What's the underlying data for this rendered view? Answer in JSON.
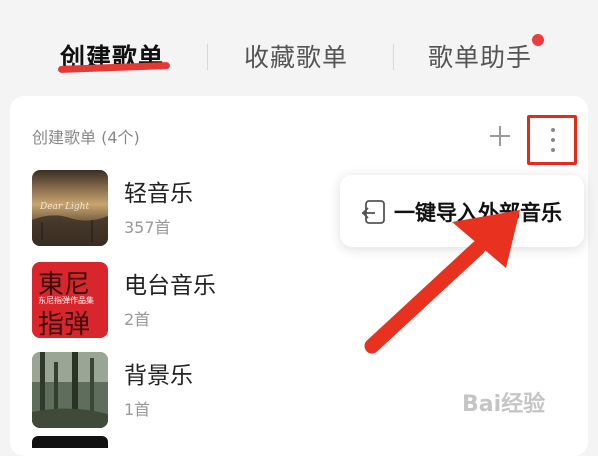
{
  "tabs": {
    "items": [
      {
        "label": "创建歌单",
        "active": true
      },
      {
        "label": "收藏歌单",
        "active": false
      },
      {
        "label": "歌单助手",
        "active": false,
        "has_dot": true
      }
    ]
  },
  "section": {
    "title": "创建歌单 (4个)",
    "actions": {
      "add_icon": "plus-icon",
      "more_icon": "more-vertical-icon"
    }
  },
  "playlists": [
    {
      "name": "轻音乐",
      "count": "357首",
      "cover_text": "Dear Light"
    },
    {
      "name": "电台音乐",
      "count": "2首",
      "cover_text_top": "東尼",
      "cover_text_mid": "东尼指弹作品集",
      "cover_text_bottom": "指弹"
    },
    {
      "name": "背景乐",
      "count": "1首"
    }
  ],
  "popup_menu": {
    "item_label": "一键导入外部音乐",
    "item_icon": "import-icon"
  },
  "watermark": "Bai经验",
  "colors": {
    "accent": "#e53935",
    "highlight_box": "#e32b1c",
    "arrow": "#e8321f"
  }
}
